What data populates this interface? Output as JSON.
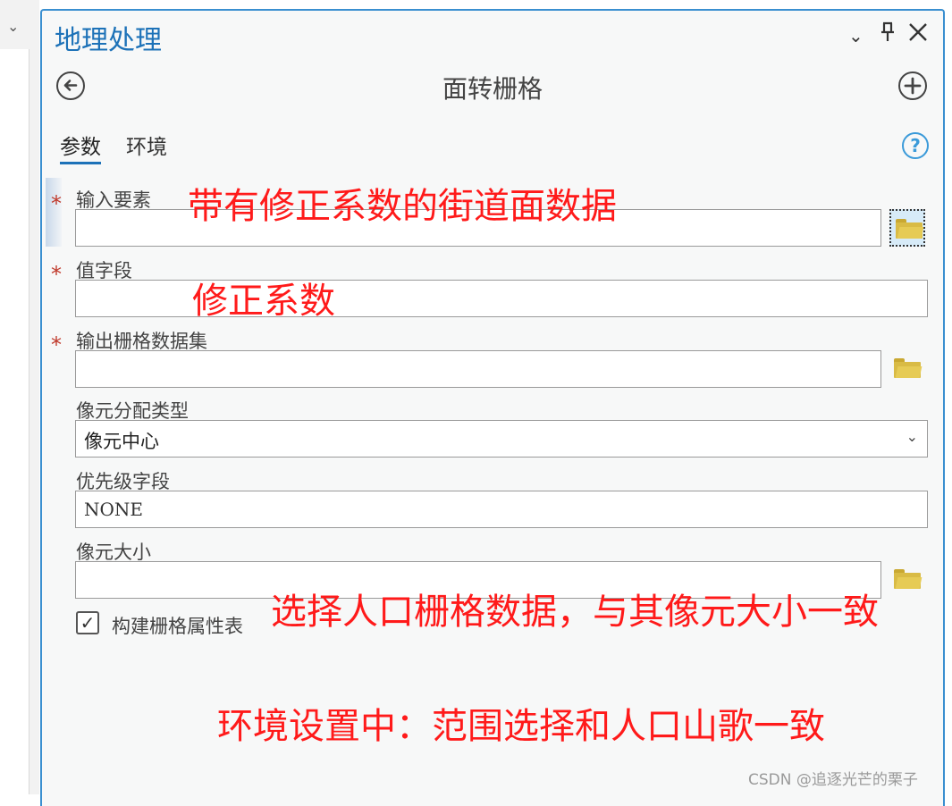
{
  "window": {
    "title": "地理处理",
    "tool_title": "面转栅格"
  },
  "icons": {
    "left_chevron": "chevron-down-icon",
    "menu": "chevron-down-icon",
    "pin": "pin-icon",
    "close": "close-icon",
    "back": "back-arrow-icon",
    "add": "add-icon",
    "help": "help-icon",
    "browse": "folder-icon",
    "checked": "checkmark-icon"
  },
  "tabs": [
    {
      "label": "参数",
      "active": true
    },
    {
      "label": "环境",
      "active": false
    }
  ],
  "help_symbol": "?",
  "params": {
    "input_features": {
      "label": "输入要素",
      "required_mark": "*",
      "value": ""
    },
    "value_field": {
      "label": "值字段",
      "required_mark": "*",
      "value": ""
    },
    "output_raster": {
      "label": "输出栅格数据集",
      "required_mark": "*",
      "value": ""
    },
    "cell_assignment": {
      "label": "像元分配类型",
      "value": "像元中心"
    },
    "priority_field": {
      "label": "优先级字段",
      "value": "NONE"
    },
    "cellsize": {
      "label": "像元大小",
      "value": ""
    },
    "build_rat": {
      "label": "构建栅格属性表",
      "checked": true,
      "check_glyph": "✓"
    }
  },
  "annotations": {
    "input_note": "带有修正系数的街道面数据",
    "field_note": "修正系数",
    "cellsize_note": "选择人口栅格数据，与其像元大小一致",
    "env_note": "环境设置中：范围选择和人口山歌一致"
  },
  "colors": {
    "accent": "#1d72b8",
    "panel_border": "#3a8fd0",
    "required": "#c0392b",
    "annotation": "#ff1a1a",
    "folder": "#d9bb45"
  },
  "watermark": "CSDN @追逐光芒的栗子"
}
